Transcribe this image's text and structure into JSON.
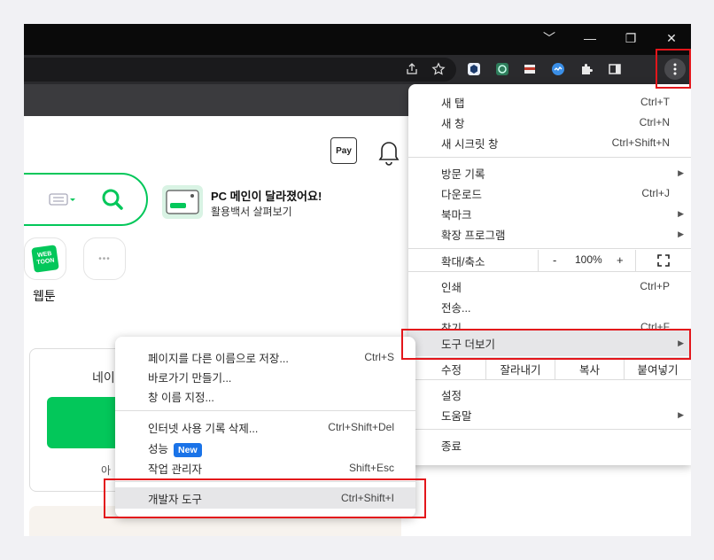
{
  "browser": {
    "window_controls": [
      "﹀",
      "—",
      "❐",
      "✕"
    ],
    "toolbar_icons": [
      "share-icon",
      "star-icon",
      "extension-1-icon",
      "extension-2-icon",
      "extension-3-icon",
      "extension-4-icon",
      "puzzle-icon",
      "sidepanel-icon",
      "kebab-menu-icon"
    ]
  },
  "page": {
    "pay_label": "Pay",
    "promo_title": "PC 메인이 달라졌어요!",
    "promo_subtitle": "활용백서 살펴보기",
    "webtoon_icon_text": "WEB TOON",
    "webtoon_label": "웹툰",
    "more_dots": "•••",
    "naver_partial": "네이",
    "partial_text": "아"
  },
  "chrome_menu": {
    "new_tab": {
      "label": "새 탭",
      "shortcut": "Ctrl+T"
    },
    "new_window": {
      "label": "새 창",
      "shortcut": "Ctrl+N"
    },
    "new_incognito": {
      "label": "새 시크릿 창",
      "shortcut": "Ctrl+Shift+N"
    },
    "history": {
      "label": "방문 기록"
    },
    "downloads": {
      "label": "다운로드",
      "shortcut": "Ctrl+J"
    },
    "bookmarks": {
      "label": "북마크"
    },
    "extensions": {
      "label": "확장 프로그램"
    },
    "zoom": {
      "label": "확대/축소",
      "minus": "-",
      "value": "100%",
      "plus": "+",
      "fullscreen": "⛶"
    },
    "print": {
      "label": "인쇄",
      "shortcut": "Ctrl+P"
    },
    "cast": {
      "label": "전송..."
    },
    "find": {
      "label": "찾기",
      "shortcut": "Ctrl+F"
    },
    "more_tools": {
      "label": "도구 더보기"
    },
    "edit": {
      "label": "수정",
      "cut": "잘라내기",
      "copy": "복사",
      "paste": "붙여넣기"
    },
    "settings": {
      "label": "설정"
    },
    "help": {
      "label": "도움말"
    },
    "exit": {
      "label": "종료"
    }
  },
  "submenu": {
    "save_page": {
      "label": "페이지를 다른 이름으로 저장...",
      "shortcut": "Ctrl+S"
    },
    "create_shortcut": {
      "label": "바로가기 만들기..."
    },
    "name_window": {
      "label": "창 이름 지정..."
    },
    "clear_data": {
      "label": "인터넷 사용 기록 삭제...",
      "shortcut": "Ctrl+Shift+Del"
    },
    "performance": {
      "label": "성능",
      "badge": "New"
    },
    "task_manager": {
      "label": "작업 관리자",
      "shortcut": "Shift+Esc"
    },
    "dev_tools": {
      "label": "개발자 도구",
      "shortcut": "Ctrl+Shift+I"
    }
  },
  "colors": {
    "highlight_red": "#e3161b",
    "naver_green": "#03c75a",
    "new_badge_blue": "#1a73e8"
  }
}
